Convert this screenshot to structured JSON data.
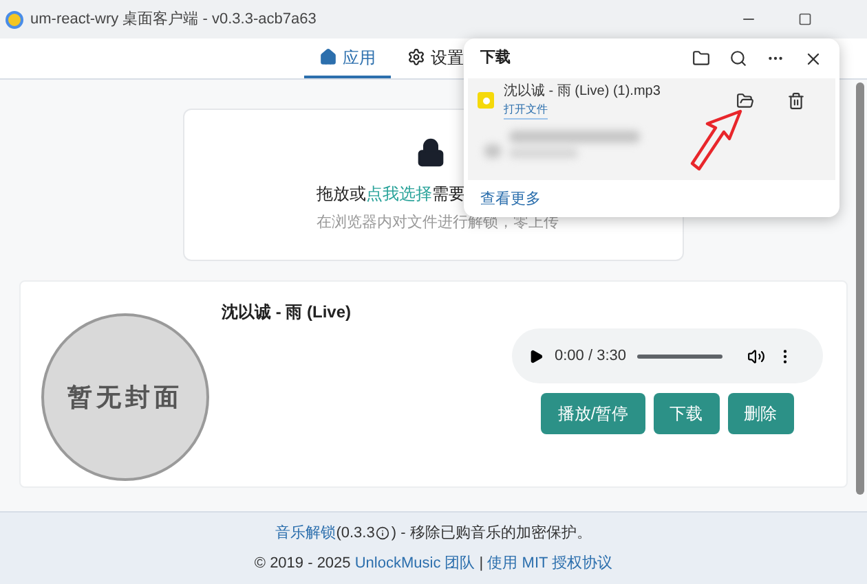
{
  "window": {
    "title": "um-react-wry 桌面客户端 - v0.3.3-acb7a63"
  },
  "tabs": [
    {
      "label": "应用",
      "selected": true
    },
    {
      "label": "设置",
      "selected": false
    }
  ],
  "drop_zone": {
    "prefix": "拖放或",
    "link": "点我选择",
    "suffix": "需要",
    "hint": "在浏览器内对文件进行解锁，零上传"
  },
  "track": {
    "cover_text": "暂无封面",
    "title": "沈以诚 - 雨 (Live)",
    "player": {
      "time": "0:00 / 3:30",
      "level": 0
    },
    "buttons": [
      "播放/暂停",
      "下载",
      "删除"
    ]
  },
  "footer": {
    "app_link": "音乐解锁",
    "version": "(0.3.3",
    "version_end": ")",
    "tagline": " - 移除已购音乐的加密保护。",
    "copyright": "© 2019 - 2025 ",
    "team_link": "UnlockMusic 团队",
    "separator": " | ",
    "license_link": "使用 MIT 授权协议"
  },
  "downloads": {
    "title": "下载",
    "items": [
      {
        "file": "沈以诚 - 雨 (Live) (1).mp3",
        "action": "打开文件"
      }
    ],
    "more": "查看更多"
  }
}
